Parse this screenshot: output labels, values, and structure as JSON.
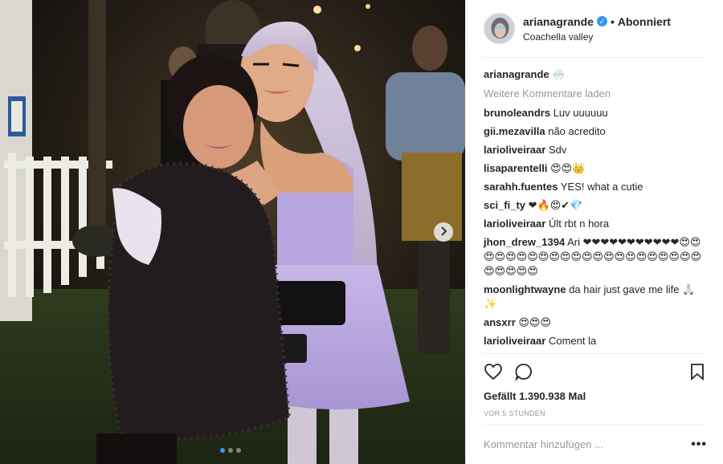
{
  "post": {
    "username": "arianagrande",
    "follow_state": "Abonniert",
    "bullet": "•",
    "verified_glyph": "✓",
    "location": "Coachella valley",
    "caption": {
      "user": "arianagrande",
      "text": "🌨️"
    },
    "load_more": "Weitere Kommentare laden",
    "comments": [
      {
        "user": "brunoleandrs",
        "text": "Luv uuuuuu"
      },
      {
        "user": "gii.mezavilla",
        "text": "não acredito"
      },
      {
        "user": "larioliveiraar",
        "text": "Sdv"
      },
      {
        "user": "lisaparentelli",
        "text": "😍😍👑"
      },
      {
        "user": "sarahh.fuentes",
        "text": "YES! what a cutie"
      },
      {
        "user": "sci_fi_ty",
        "text": "❤🔥😍✔💎"
      },
      {
        "user": "larioliveiraar",
        "text": "Últ rbt n hora"
      },
      {
        "user": "jhon_drew_1394",
        "text": "Ari ❤❤❤❤❤❤❤❤❤❤❤😍😍😍😍😍😍😍😍😍😍😍😍😍😍😍😍😍😍😍😍😍😍😍😍😍😍😍"
      },
      {
        "user": "moonlightwayne",
        "text": "da hair just gave me life 🙏🏻✨"
      },
      {
        "user": "ansxrr",
        "text": "😍😍😍"
      },
      {
        "user": "larioliveiraar",
        "text": "Coment la"
      }
    ],
    "likes": "Gefällt 1.390.938 Mal",
    "time": "VOR 5 STUNDEN",
    "comment_placeholder": "Kommentar hinzufügen ...",
    "more_glyph": "•••"
  },
  "icons": {
    "like": "heart-outline-icon",
    "comment": "speech-bubble-icon",
    "save": "bookmark-icon",
    "next": "chevron-right-icon"
  },
  "colors": {
    "accent": "#3897f0",
    "muted": "#999999",
    "text": "#262626",
    "divider": "#efefef"
  },
  "carousel": {
    "slides": 3,
    "active": 1
  }
}
